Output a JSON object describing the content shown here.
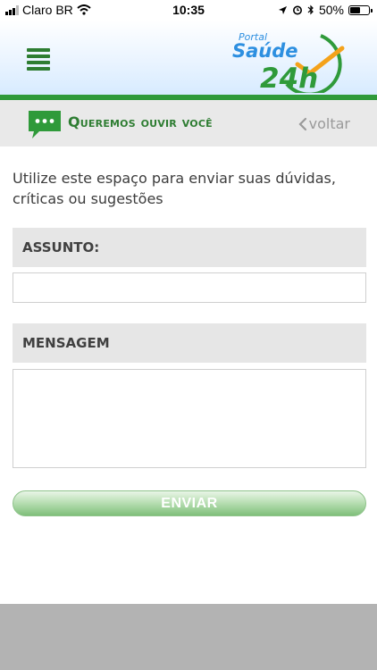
{
  "status_bar": {
    "carrier": "Claro BR",
    "time": "10:35",
    "battery": "50%"
  },
  "header": {
    "logo": {
      "small": "Portal",
      "main": "Saúde",
      "number": "24h"
    }
  },
  "titlebar": {
    "title": "Queremos ouvir você",
    "back_label": "voltar"
  },
  "form": {
    "intro": "Utilize este espaço para enviar suas dúvidas, críticas ou sugestões",
    "subject_label": "ASSUNTO:",
    "subject_value": "",
    "message_label": "MENSAGEM",
    "message_value": "",
    "send_label": "ENVIAR"
  },
  "colors": {
    "brand_green": "#2f9a3a",
    "brand_blue": "#2d8fe0",
    "accent_orange": "#f4a21b"
  }
}
